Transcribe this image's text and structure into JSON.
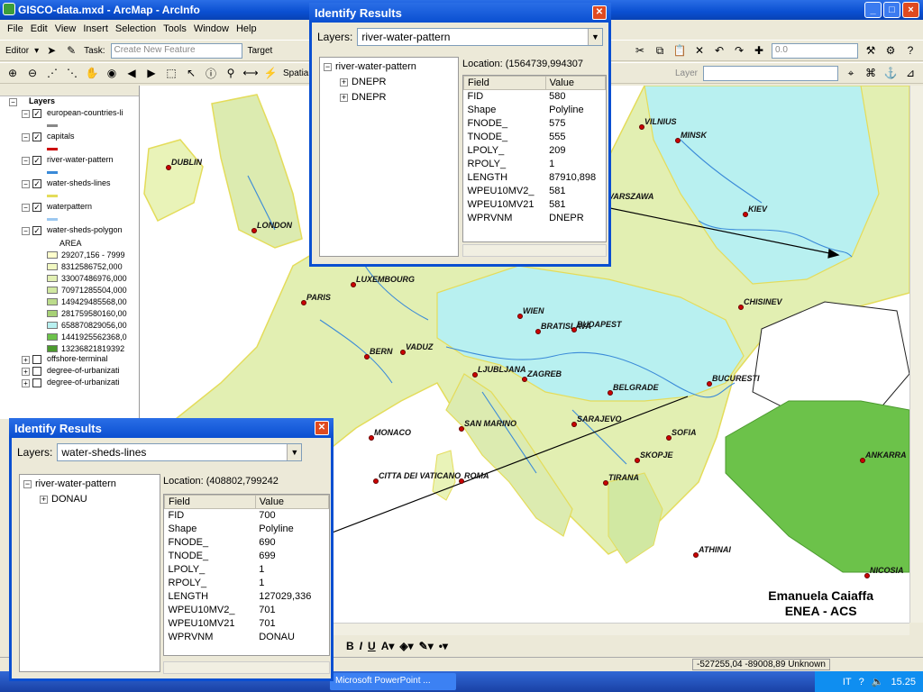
{
  "app": {
    "title": "GISCO-data.mxd - ArcMap - ArcInfo",
    "menu": [
      "File",
      "Edit",
      "View",
      "Insert",
      "Selection",
      "Tools",
      "Window",
      "Help"
    ],
    "toolbar": {
      "editor_label": "Editor",
      "task_label": "Task:",
      "task_value": "Create New Feature",
      "target_label": "Target",
      "spatial_label": "Spatial Analyst",
      "layer_label": "Layer",
      "zoom_value": "0.0"
    }
  },
  "toc": {
    "root": "Layers",
    "layers": [
      {
        "name": "european-countries-li",
        "checked": true
      },
      {
        "name": "capitals",
        "checked": true
      },
      {
        "name": "river-water-pattern",
        "checked": true
      },
      {
        "name": "water-sheds-lines",
        "checked": true
      },
      {
        "name": "waterpattern",
        "checked": true
      },
      {
        "name": "water-sheds-polygon",
        "checked": true
      },
      {
        "name": "offshore-terminal",
        "checked": false
      },
      {
        "name": "degree-of-urbanizati",
        "checked": false
      },
      {
        "name": "degree-of-urbanizati",
        "checked": false
      }
    ],
    "area_label": "AREA",
    "classes": [
      {
        "label": "29207,156 - 7999",
        "color": "#ffffcc"
      },
      {
        "label": "8312586752,000",
        "color": "#f1f8c2"
      },
      {
        "label": "33007486976,000",
        "color": "#e2f0b3"
      },
      {
        "label": "70971285504,000",
        "color": "#d1e8a2"
      },
      {
        "label": "149429485568,00",
        "color": "#bcdc8c"
      },
      {
        "label": "281759580160,00",
        "color": "#a7d176"
      },
      {
        "label": "658870829056,00",
        "color": "#b8f0f0"
      },
      {
        "label": "1441925562368,0",
        "color": "#6cc24a"
      },
      {
        "label": "13236821819392",
        "color": "#4b9a2e"
      }
    ]
  },
  "map": {
    "cities": [
      {
        "name": "DUBLIN"
      },
      {
        "name": "LONDON"
      },
      {
        "name": "PARIS"
      },
      {
        "name": "LUXEMBOURG"
      },
      {
        "name": "BERN"
      },
      {
        "name": "VADUZ"
      },
      {
        "name": "WIEN"
      },
      {
        "name": "BRATISLAVA"
      },
      {
        "name": "BUDAPEST"
      },
      {
        "name": "LJUBLJANA"
      },
      {
        "name": "ZAGREB"
      },
      {
        "name": "BELGRADE"
      },
      {
        "name": "SARAJEVO"
      },
      {
        "name": "MONACO"
      },
      {
        "name": "SAN MARINO"
      },
      {
        "name": "CITTA DEI VATICANO"
      },
      {
        "name": "ROMA"
      },
      {
        "name": "TIRANA"
      },
      {
        "name": "SKOPJE"
      },
      {
        "name": "SOFIA"
      },
      {
        "name": "BUCURESTI"
      },
      {
        "name": "CHISINEV"
      },
      {
        "name": "KIEV"
      },
      {
        "name": "MINSK"
      },
      {
        "name": "VILNIUS"
      },
      {
        "name": "VARSZAWA"
      },
      {
        "name": "ATHINAI"
      },
      {
        "name": "ANKARRA"
      },
      {
        "name": "NICOSIA"
      }
    ],
    "credit_line1": "Emanuela Caiaffa",
    "credit_line2": "ENEA - ACS"
  },
  "identify_top": {
    "title": "Identify Results",
    "layers_label": "Layers:",
    "layer_value": "river-water-pattern",
    "tree_root": "river-water-pattern",
    "tree_items": [
      "DNEPR",
      "DNEPR"
    ],
    "location": "Location: (1564739,994307",
    "columns": [
      "Field",
      "Value"
    ],
    "rows": [
      [
        "FID",
        "580"
      ],
      [
        "Shape",
        "Polyline"
      ],
      [
        "FNODE_",
        "575"
      ],
      [
        "TNODE_",
        "555"
      ],
      [
        "LPOLY_",
        "209"
      ],
      [
        "RPOLY_",
        "1"
      ],
      [
        "LENGTH",
        "87910,898"
      ],
      [
        "WPEU10MV2_",
        "581"
      ],
      [
        "WPEU10MV21",
        "581"
      ],
      [
        "WPRVNM",
        "DNEPR"
      ]
    ]
  },
  "identify_bottom": {
    "title": "Identify Results",
    "layers_label": "Layers:",
    "layer_value": "water-sheds-lines",
    "tree_root": "river-water-pattern",
    "tree_items": [
      "DONAU"
    ],
    "location": "Location: (408802,799242",
    "columns": [
      "Field",
      "Value"
    ],
    "rows": [
      [
        "FID",
        "700"
      ],
      [
        "Shape",
        "Polyline"
      ],
      [
        "FNODE_",
        "690"
      ],
      [
        "TNODE_",
        "699"
      ],
      [
        "LPOLY_",
        "1"
      ],
      [
        "RPOLY_",
        "1"
      ],
      [
        "LENGTH",
        "127029,336"
      ],
      [
        "WPEU10MV2_",
        "701"
      ],
      [
        "WPEU10MV21",
        "701"
      ],
      [
        "WPRVNM",
        "DONAU"
      ]
    ]
  },
  "status": {
    "coords": "-527255,04  -89008,89 Unknown"
  },
  "taskbar": {
    "task": "Microsoft PowerPoint ...",
    "lang": "IT",
    "time": "15.25"
  }
}
